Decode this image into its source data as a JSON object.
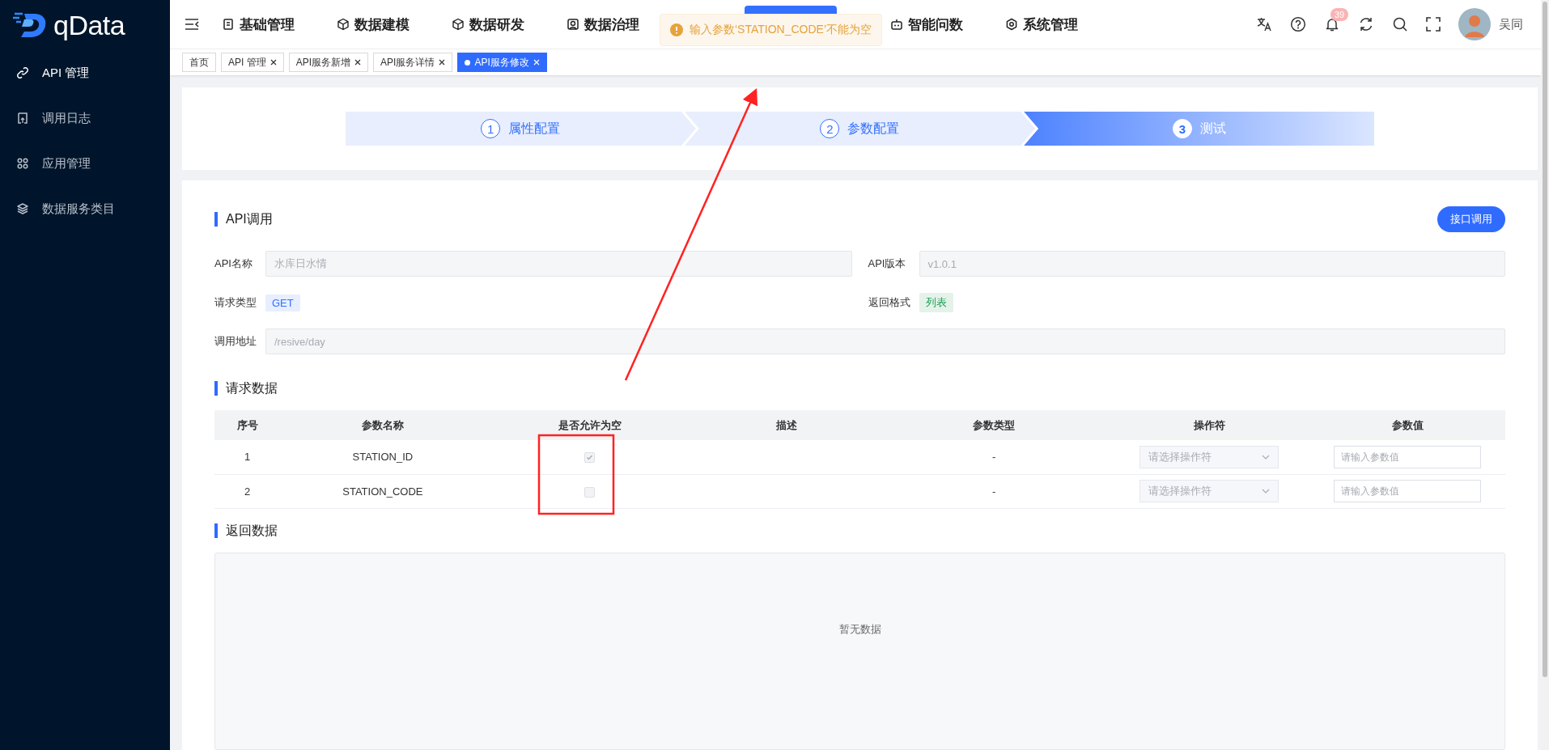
{
  "sidebar": {
    "logo": "qData",
    "items": [
      {
        "label": "API 管理",
        "selected": true
      },
      {
        "label": "调用日志",
        "selected": false
      },
      {
        "label": "应用管理",
        "selected": false
      },
      {
        "label": "数据服务类目",
        "selected": false
      }
    ]
  },
  "topbar": {
    "nav": [
      {
        "kind": "item",
        "label": "基础管理"
      },
      {
        "kind": "item",
        "label": "数据建模"
      },
      {
        "kind": "item",
        "label": "数据研发"
      },
      {
        "kind": "item",
        "label": "数据治理"
      },
      {
        "kind": "hidden"
      },
      {
        "kind": "item",
        "label": "智能问数"
      },
      {
        "kind": "item",
        "label": "系统管理"
      }
    ],
    "toast": {
      "text": "输入参数‘STATION_CODE’不能为空"
    },
    "notification_count": "39",
    "user": "吴同"
  },
  "tabs": [
    {
      "label": "首页",
      "closable": false,
      "selected": false
    },
    {
      "label": "API 管理",
      "closable": true,
      "selected": false
    },
    {
      "label": "API服务新增",
      "closable": true,
      "selected": false
    },
    {
      "label": "API服务详情",
      "closable": true,
      "selected": false
    },
    {
      "label": "API服务修改",
      "closable": true,
      "selected": true
    }
  ],
  "steps": [
    {
      "number": "1",
      "label": "属性配置",
      "selected": false
    },
    {
      "number": "2",
      "label": "参数配置",
      "selected": false
    },
    {
      "number": "3",
      "label": "测试",
      "selected": true
    }
  ],
  "api_call": {
    "title": "API调用",
    "button": "接口调用",
    "fields": [
      {
        "label": "API名称",
        "kind": "input",
        "value": "水库日水情"
      },
      {
        "label": "API版本",
        "kind": "input",
        "value": "v1.0.1"
      },
      {
        "label": "请求类型",
        "kind": "tag",
        "value": "GET",
        "color": "#3370ff"
      },
      {
        "label": "返回格式",
        "kind": "tag",
        "value": "列表",
        "color": "#1f9d55"
      },
      {
        "label": "调用地址",
        "kind": "long_input",
        "value": "/resive/day"
      }
    ]
  },
  "request_data": {
    "title": "请求数据",
    "columns": [
      "序号",
      "参数名称",
      "是否允许为空",
      "描述",
      "参数类型",
      "操作符",
      "参数值"
    ],
    "rows": [
      {
        "index": "1",
        "name": "STATION_ID",
        "nullable": {
          "checked": true,
          "disabled": true
        },
        "type": "-",
        "operator": {
          "placeholder": "请选择操作符",
          "disabled": true
        },
        "value": {
          "placeholder": "请输入参数值"
        }
      },
      {
        "index": "2",
        "name": "STATION_CODE",
        "nullable": {
          "checked": false,
          "disabled": true
        },
        "type": "-",
        "operator": {
          "placeholder": "请选择操作符",
          "disabled": true
        },
        "value": {
          "placeholder": "请输入参数值"
        }
      }
    ]
  },
  "response_data": {
    "title": "返回数据",
    "empty_text": "暂无数据"
  }
}
